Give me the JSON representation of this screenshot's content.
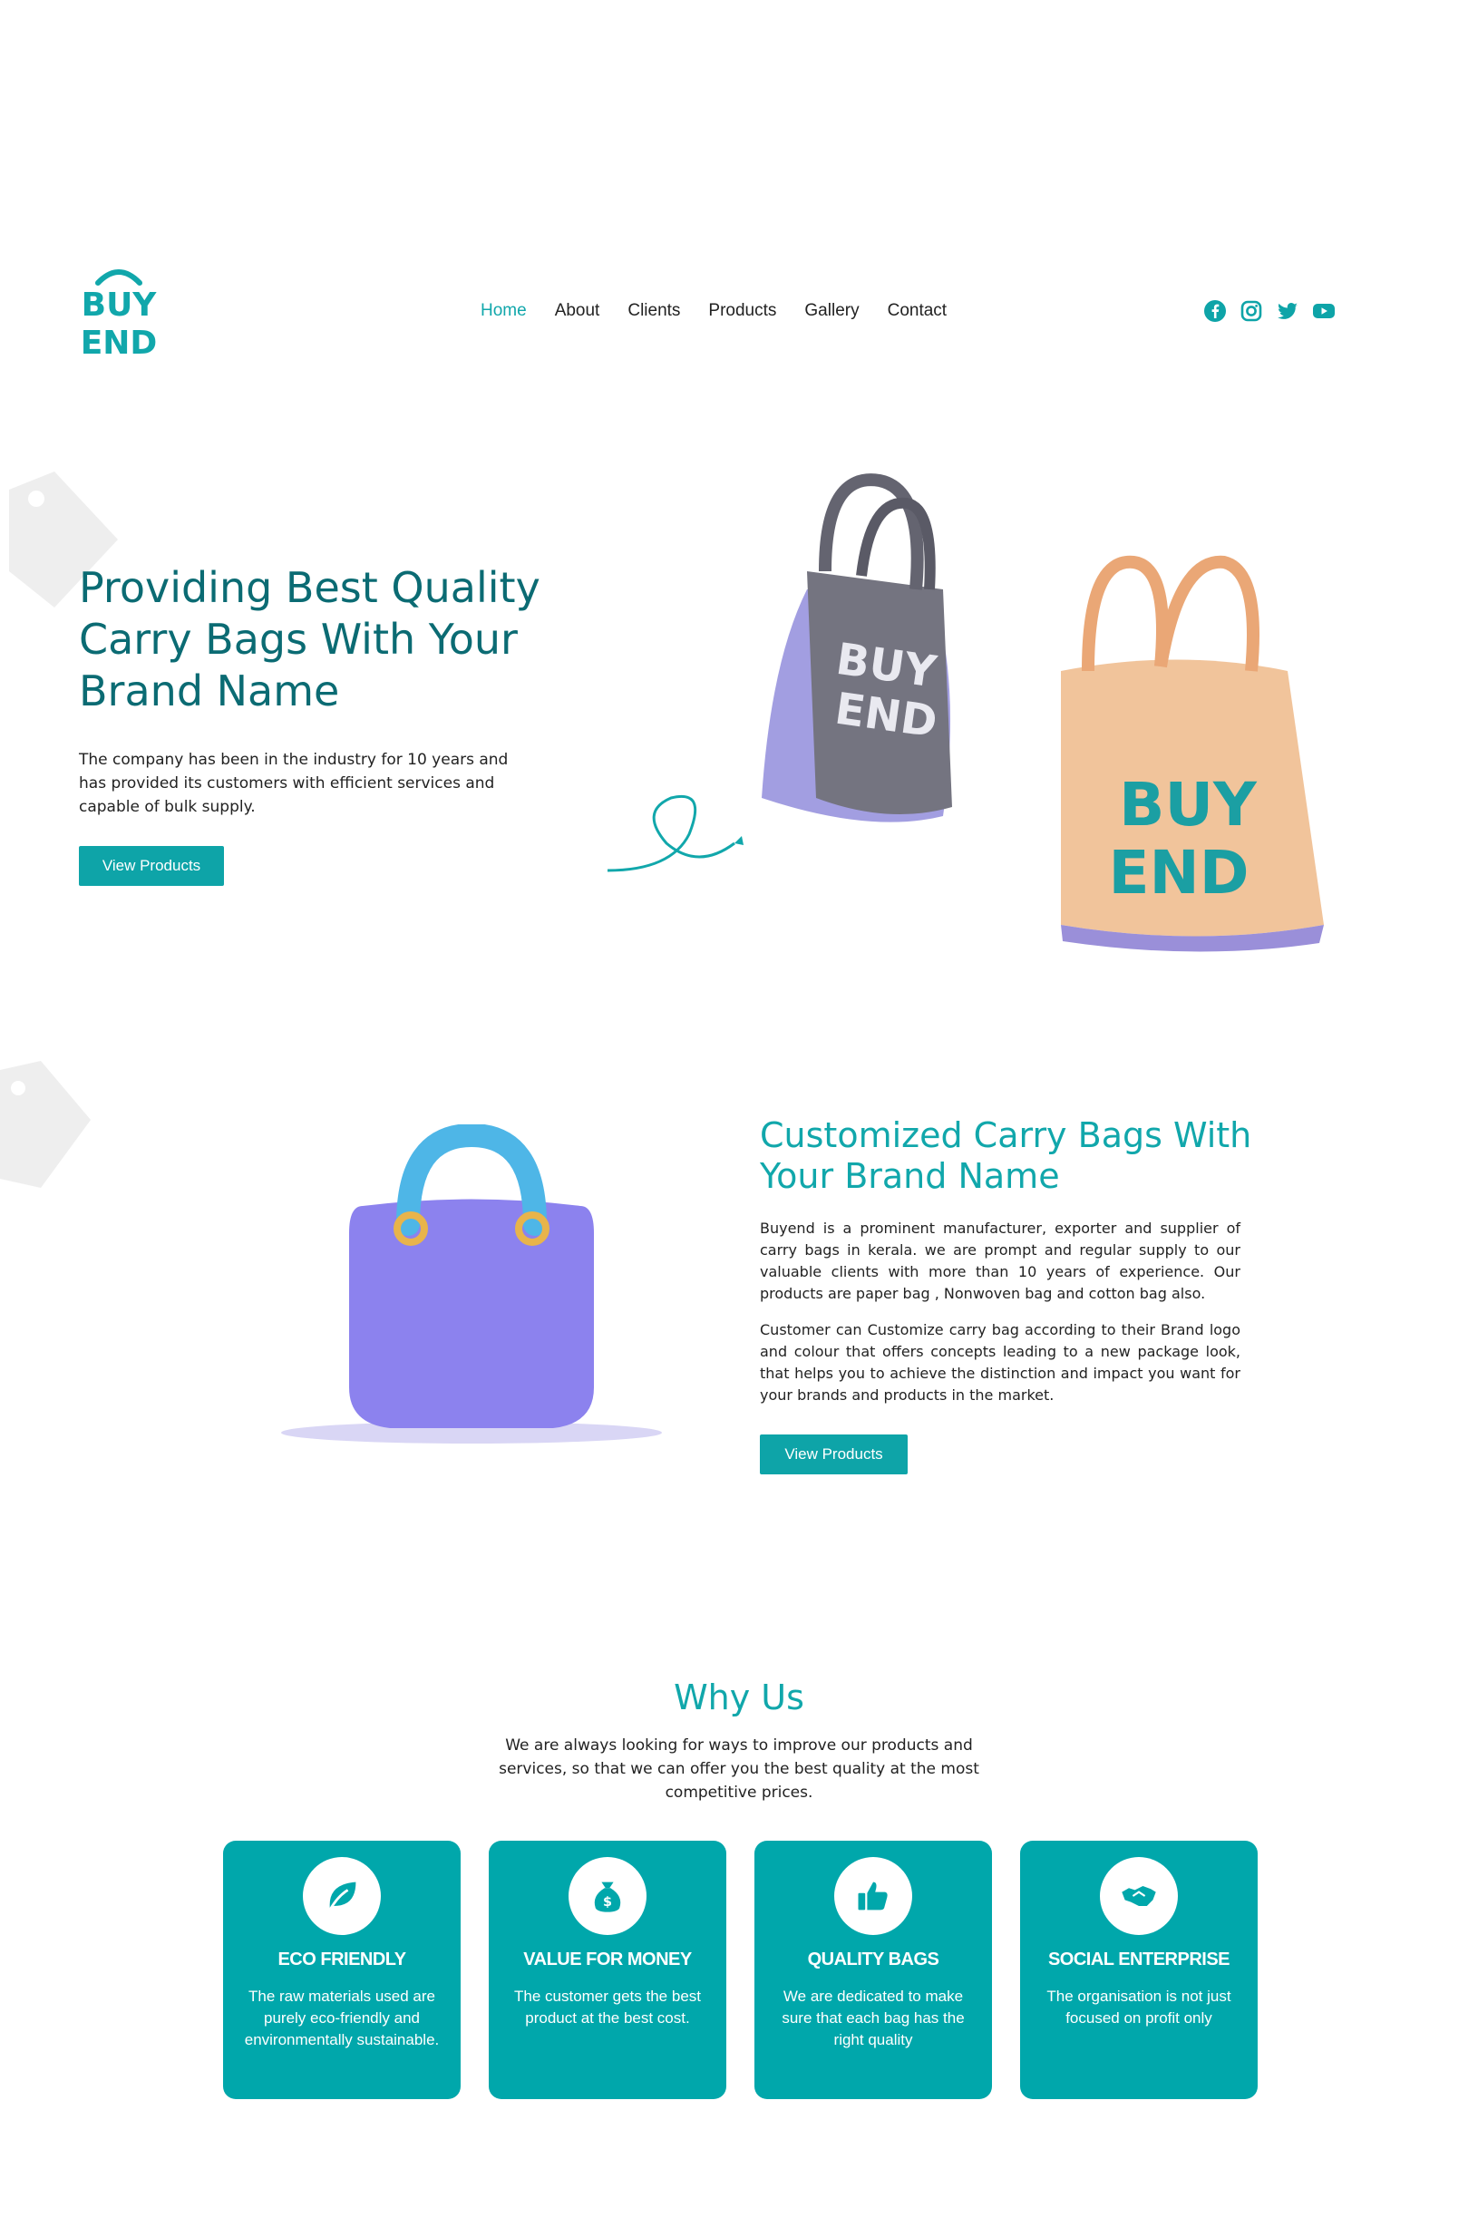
{
  "brand": {
    "logo_line1": "BUY",
    "logo_line2": "END"
  },
  "nav": {
    "items": [
      {
        "label": "Home"
      },
      {
        "label": "About"
      },
      {
        "label": "Clients"
      },
      {
        "label": "Products"
      },
      {
        "label": "Gallery"
      },
      {
        "label": "Contact"
      }
    ]
  },
  "social": {
    "icons": [
      "facebook-icon",
      "instagram-icon",
      "twitter-icon",
      "youtube-icon"
    ]
  },
  "hero": {
    "title": "Providing Best Quality Carry Bags With Your Brand Name",
    "text": "The company has been in the industry for 10 years and has provided its customers with efficient services and capable of bulk supply.",
    "button": "View Products"
  },
  "about": {
    "title": "Customized Carry Bags With Your Brand Name",
    "p1": "Buyend is a prominent manufacturer, exporter and supplier of carry bags in kerala. we are prompt and regular supply to our valuable clients with more than 10 years of experience. Our products are paper bag , Nonwoven bag and cotton bag also.",
    "p2": "Customer can Customize carry bag according to their Brand logo and colour that offers concepts leading to a new package look, that helps you to achieve the distinction and impact you want for your brands and products in the market.",
    "button": "View Products"
  },
  "why": {
    "title": "Why Us",
    "subtitle": "We are always looking for ways to improve our products and services, so that we can offer you the best quality at the most competitive prices.",
    "cards": [
      {
        "title": "ECO FRIENDLY",
        "text": "The raw materials used are purely eco-friendly and environmentally sustainable.",
        "icon": "leaf-icon"
      },
      {
        "title": "VALUE FOR MONEY",
        "text": "The customer gets the best product at the best cost.",
        "icon": "money-bag-icon"
      },
      {
        "title": "QUALITY BAGS",
        "text": "We are dedicated to make sure that each bag has the right quality",
        "icon": "thumbs-up-icon"
      },
      {
        "title": "SOCIAL ENTERPRISE",
        "text": "The organisation is not just focused on profit only",
        "icon": "handshake-icon"
      }
    ]
  },
  "colors": {
    "accent": "#11a7ab",
    "dark_teal": "#0b6b73",
    "card_bg": "#00a7ab"
  }
}
